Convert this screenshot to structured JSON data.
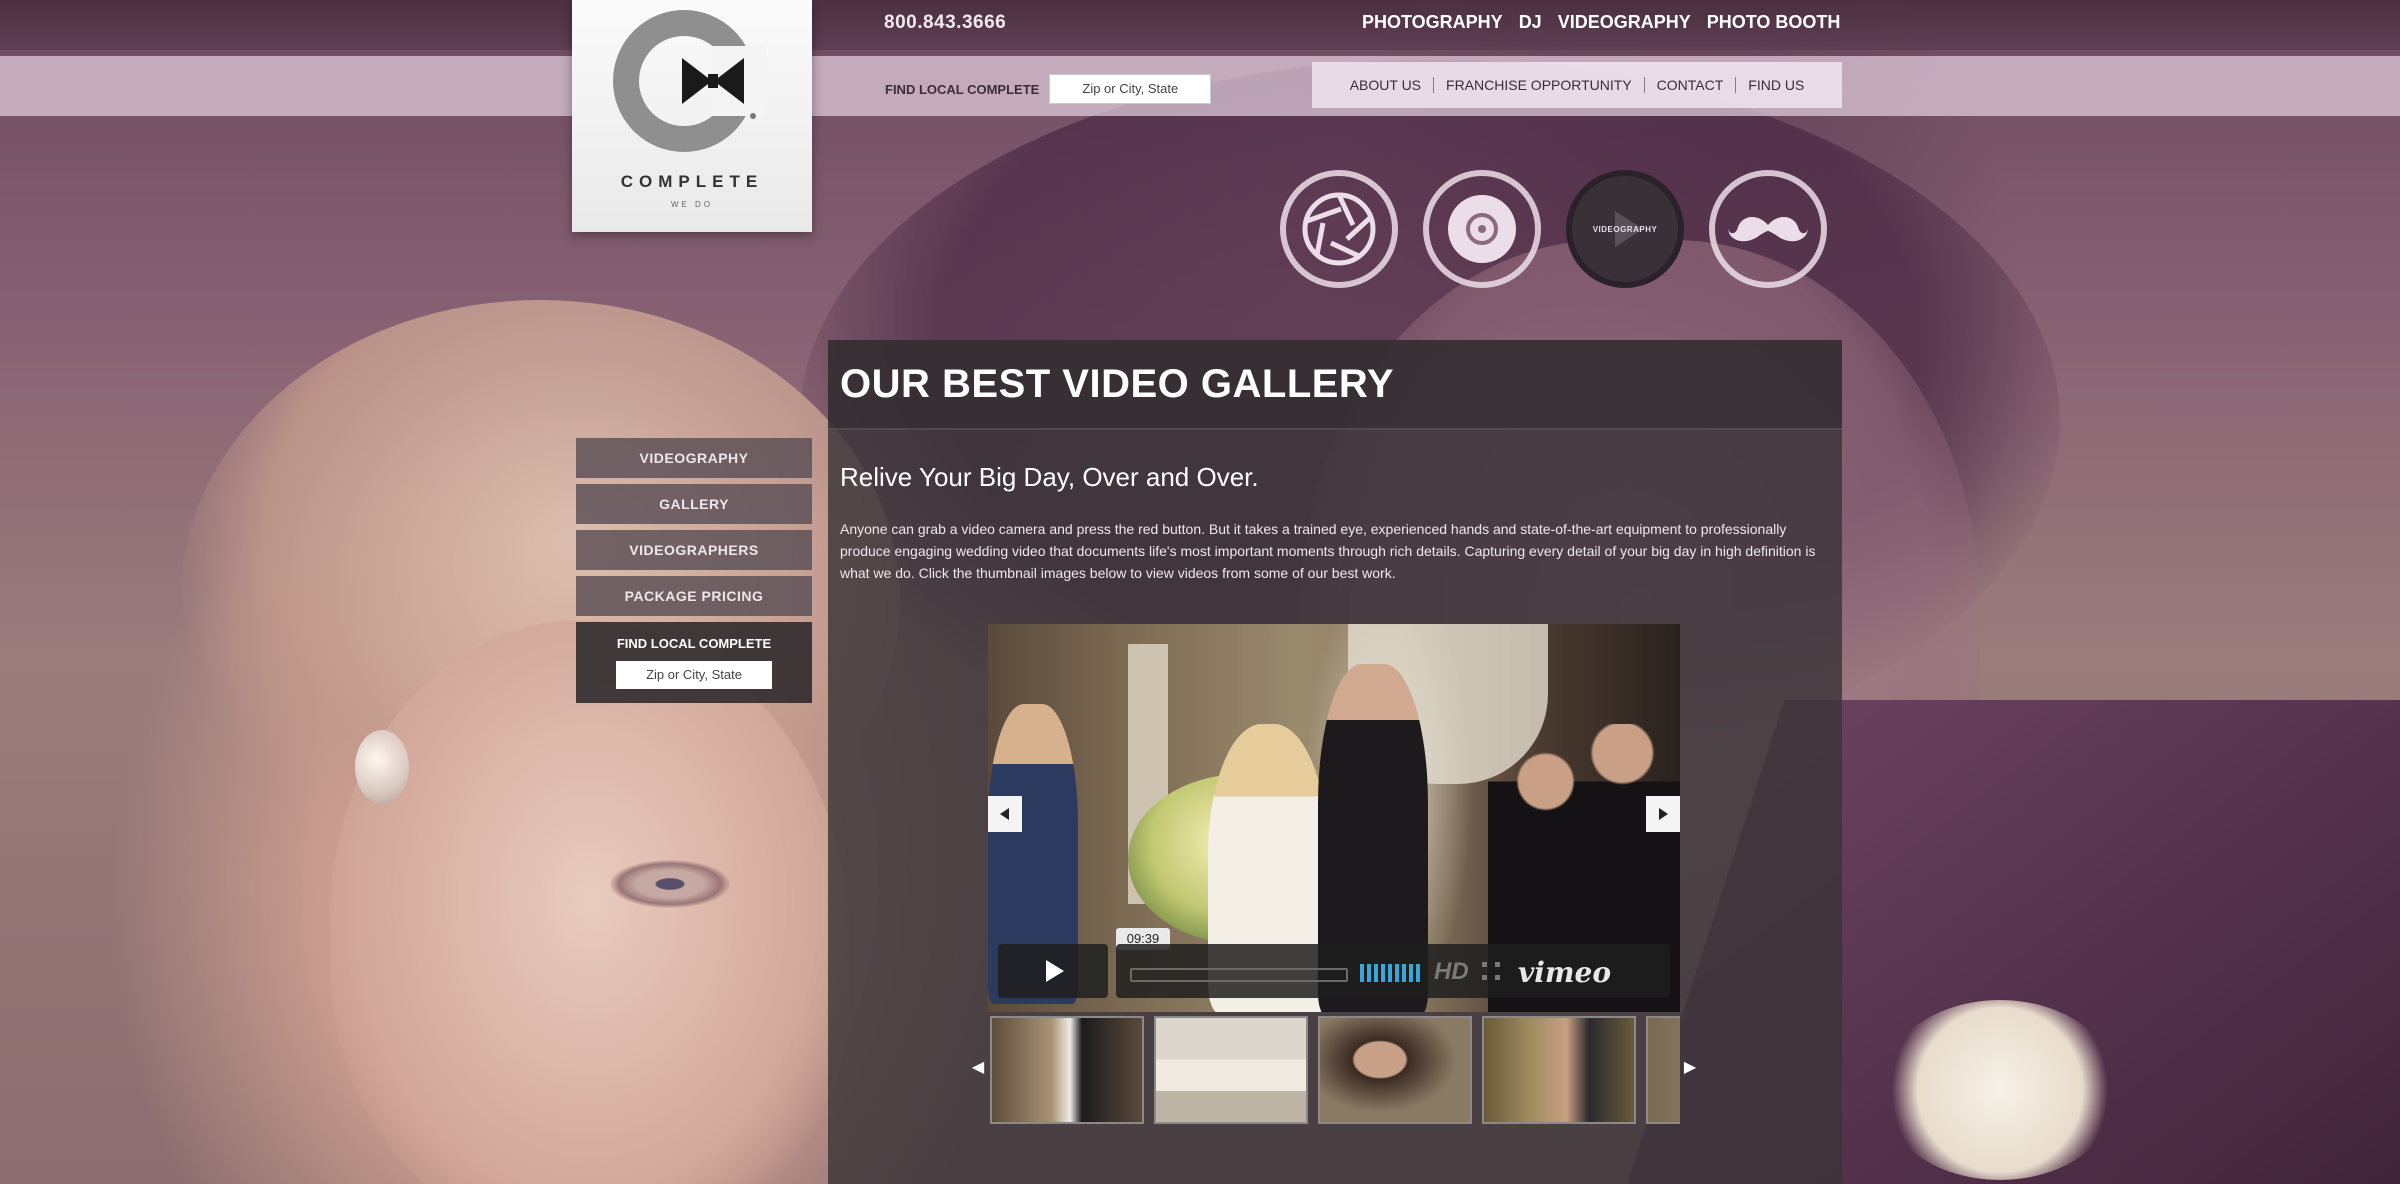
{
  "header": {
    "phone": "800.843.3666",
    "top_nav": [
      "PHOTOGRAPHY",
      "DJ",
      "VIDEOGRAPHY",
      "PHOTO BOOTH"
    ],
    "find_local_label": "FIND LOCAL COMPLETE",
    "zip_placeholder": "Zip or City, State",
    "sub_nav": [
      "ABOUT US",
      "FRANCHISE OPPORTUNITY",
      "CONTACT",
      "FIND US"
    ]
  },
  "logo": {
    "word": "COMPLETE",
    "tagline": "WE DO"
  },
  "services": [
    {
      "name": "photography",
      "icon": "aperture-icon",
      "label": ""
    },
    {
      "name": "dj",
      "icon": "record-icon",
      "label": ""
    },
    {
      "name": "videography",
      "icon": "play-icon",
      "label": "VIDEOGRAPHY",
      "active": true
    },
    {
      "name": "photo-booth",
      "icon": "mustache-icon",
      "label": ""
    }
  ],
  "sidebar": {
    "items": [
      "VIDEOGRAPHY",
      "GALLERY",
      "VIDEOGRAPHERS",
      "PACKAGE PRICING"
    ],
    "find_local_label": "FIND LOCAL COMPLETE",
    "zip_placeholder": "Zip or City, State"
  },
  "main": {
    "title": "OUR BEST VIDEO GALLERY",
    "subtitle": "Relive Your Big Day, Over and Over.",
    "body": "Anyone can grab a video camera and press the red button. But it takes a trained eye, experienced hands and state-of-the-art equipment to professionally produce engaging wedding video that documents life's most important moments through rich details. Capturing every detail of your big day in high definition is what we do. Click the thumbnail images below to view videos from some of our best work."
  },
  "player": {
    "timecode": "09:39",
    "hd_label": "HD",
    "brand": "vimeo",
    "volume_bars": 9
  },
  "thumbnails": [
    "video-1",
    "video-2",
    "video-3",
    "video-4",
    "video-5"
  ],
  "colors": {
    "accent_volume": "#39a7d6",
    "panel": "#3a3438",
    "header_tint": "#482c3e"
  }
}
